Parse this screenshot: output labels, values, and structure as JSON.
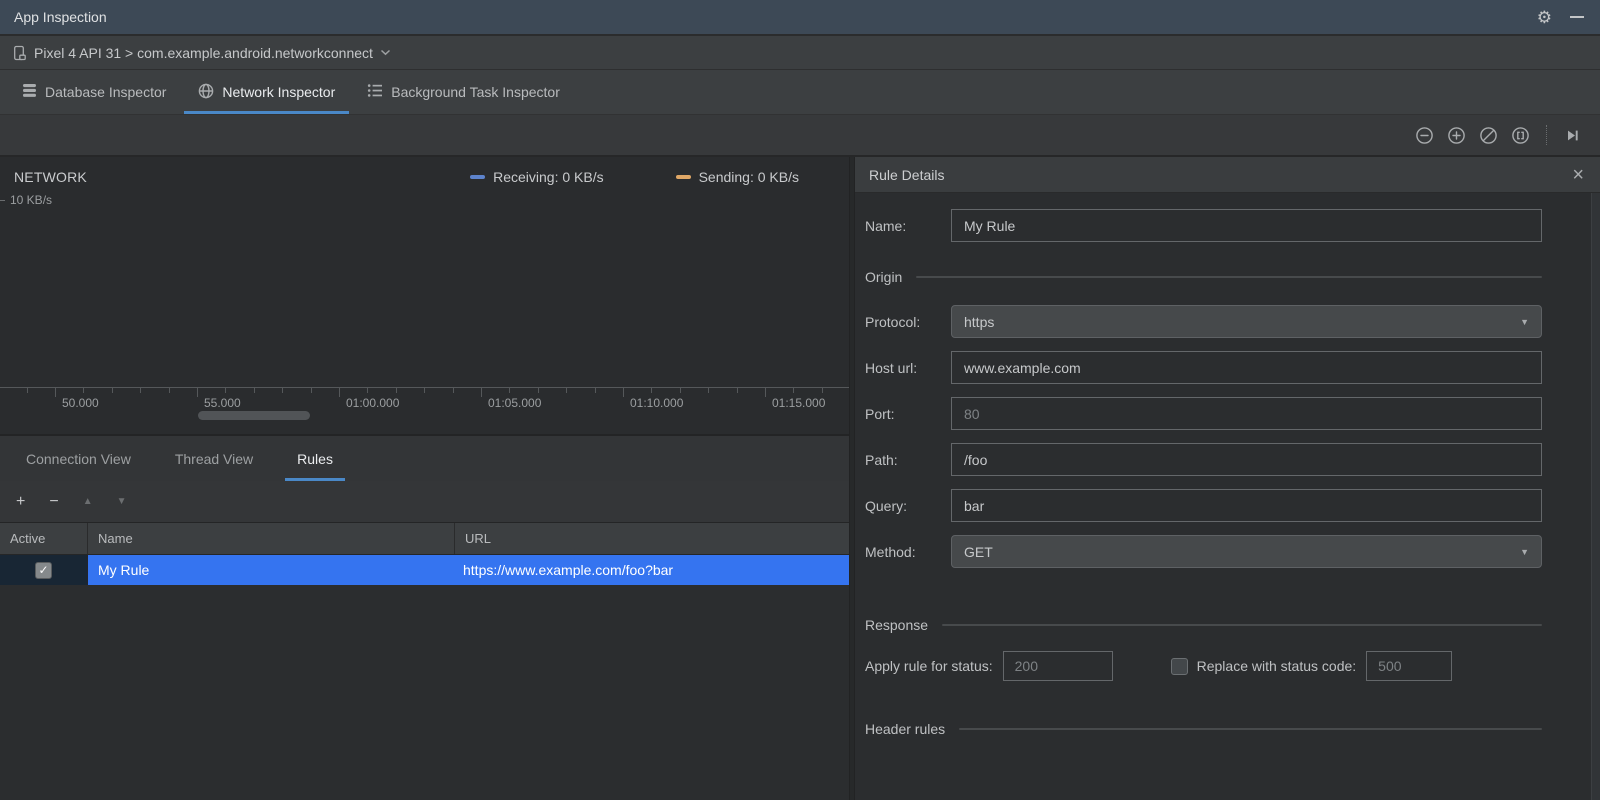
{
  "colors": {
    "selection": "#3574F0",
    "underline": "#4A88C7",
    "receiving": "#5D83CC",
    "sending": "#DFA766"
  },
  "window": {
    "title": "App Inspection",
    "device_selector": "Pixel 4 API 31 > com.example.android.networkconnect"
  },
  "inspector_tabs": [
    {
      "label": "Database Inspector",
      "icon": "database-icon",
      "active": false
    },
    {
      "label": "Network Inspector",
      "icon": "globe-icon",
      "active": true
    },
    {
      "label": "Background Task Inspector",
      "icon": "list-icon",
      "active": false
    }
  ],
  "main_toolbar": {
    "icons": [
      "zoom-out-icon",
      "zoom-in-icon",
      "reset-zoom-icon",
      "zoom-selection-icon",
      "separator",
      "skip-end-icon"
    ]
  },
  "chart_data": {
    "type": "line",
    "title": "NETWORK",
    "y_tick_label": "10 KB/s",
    "ylim": [
      0,
      10
    ],
    "x_ticks": [
      "50.000",
      "55.000",
      "01:00.000",
      "01:05.000",
      "01:10.000",
      "01:15.000"
    ],
    "series": [
      {
        "name": "Receiving",
        "legend_label": "Receiving: 0 KB/s",
        "color": "#5D83CC",
        "current_value": 0,
        "values": [
          0,
          0,
          0,
          0,
          0,
          0
        ]
      },
      {
        "name": "Sending",
        "legend_label": "Sending: 0 KB/s",
        "color": "#DFA766",
        "current_value": 0,
        "values": [
          0,
          0,
          0,
          0,
          0,
          0
        ]
      }
    ],
    "legend_position": "top-right",
    "grid": false
  },
  "sub_tabs": [
    {
      "label": "Connection View",
      "active": false
    },
    {
      "label": "Thread View",
      "active": false
    },
    {
      "label": "Rules",
      "active": true
    }
  ],
  "rules_toolbar": [
    {
      "name": "add-rule-button",
      "icon": "add-icon",
      "enabled": true
    },
    {
      "name": "remove-rule-button",
      "icon": "remove-icon",
      "enabled": true
    },
    {
      "name": "move-up-button",
      "icon": "up-icon",
      "enabled": false
    },
    {
      "name": "move-down-button",
      "icon": "down-icon",
      "enabled": false
    }
  ],
  "rules_table": {
    "columns": [
      "Active",
      "Name",
      "URL"
    ],
    "rows": [
      {
        "active": true,
        "name": "My Rule",
        "url": "https://www.example.com/foo?bar",
        "selected": true
      }
    ]
  },
  "rule_details": {
    "title": "Rule Details",
    "close_glyph": "×",
    "name_field": {
      "label": "Name:",
      "value": "My Rule"
    },
    "sections": {
      "origin": "Origin",
      "response": "Response",
      "header_rules": "Header rules"
    },
    "origin_fields": [
      {
        "label": "Protocol:",
        "value": "https",
        "type": "select",
        "muted": false
      },
      {
        "label": "Host url:",
        "value": "www.example.com",
        "type": "text",
        "muted": false
      },
      {
        "label": "Port:",
        "value": "80",
        "type": "text",
        "muted": true
      },
      {
        "label": "Path:",
        "value": "/foo",
        "type": "text",
        "muted": false
      },
      {
        "label": "Query:",
        "value": "bar",
        "type": "text",
        "muted": false
      },
      {
        "label": "Method:",
        "value": "GET",
        "type": "select",
        "muted": false
      }
    ],
    "response_fields": {
      "apply_label": "Apply rule for status:",
      "apply_value": "200",
      "replace_checkbox_checked": false,
      "replace_label": "Replace with status code:",
      "replace_value": "500"
    }
  }
}
